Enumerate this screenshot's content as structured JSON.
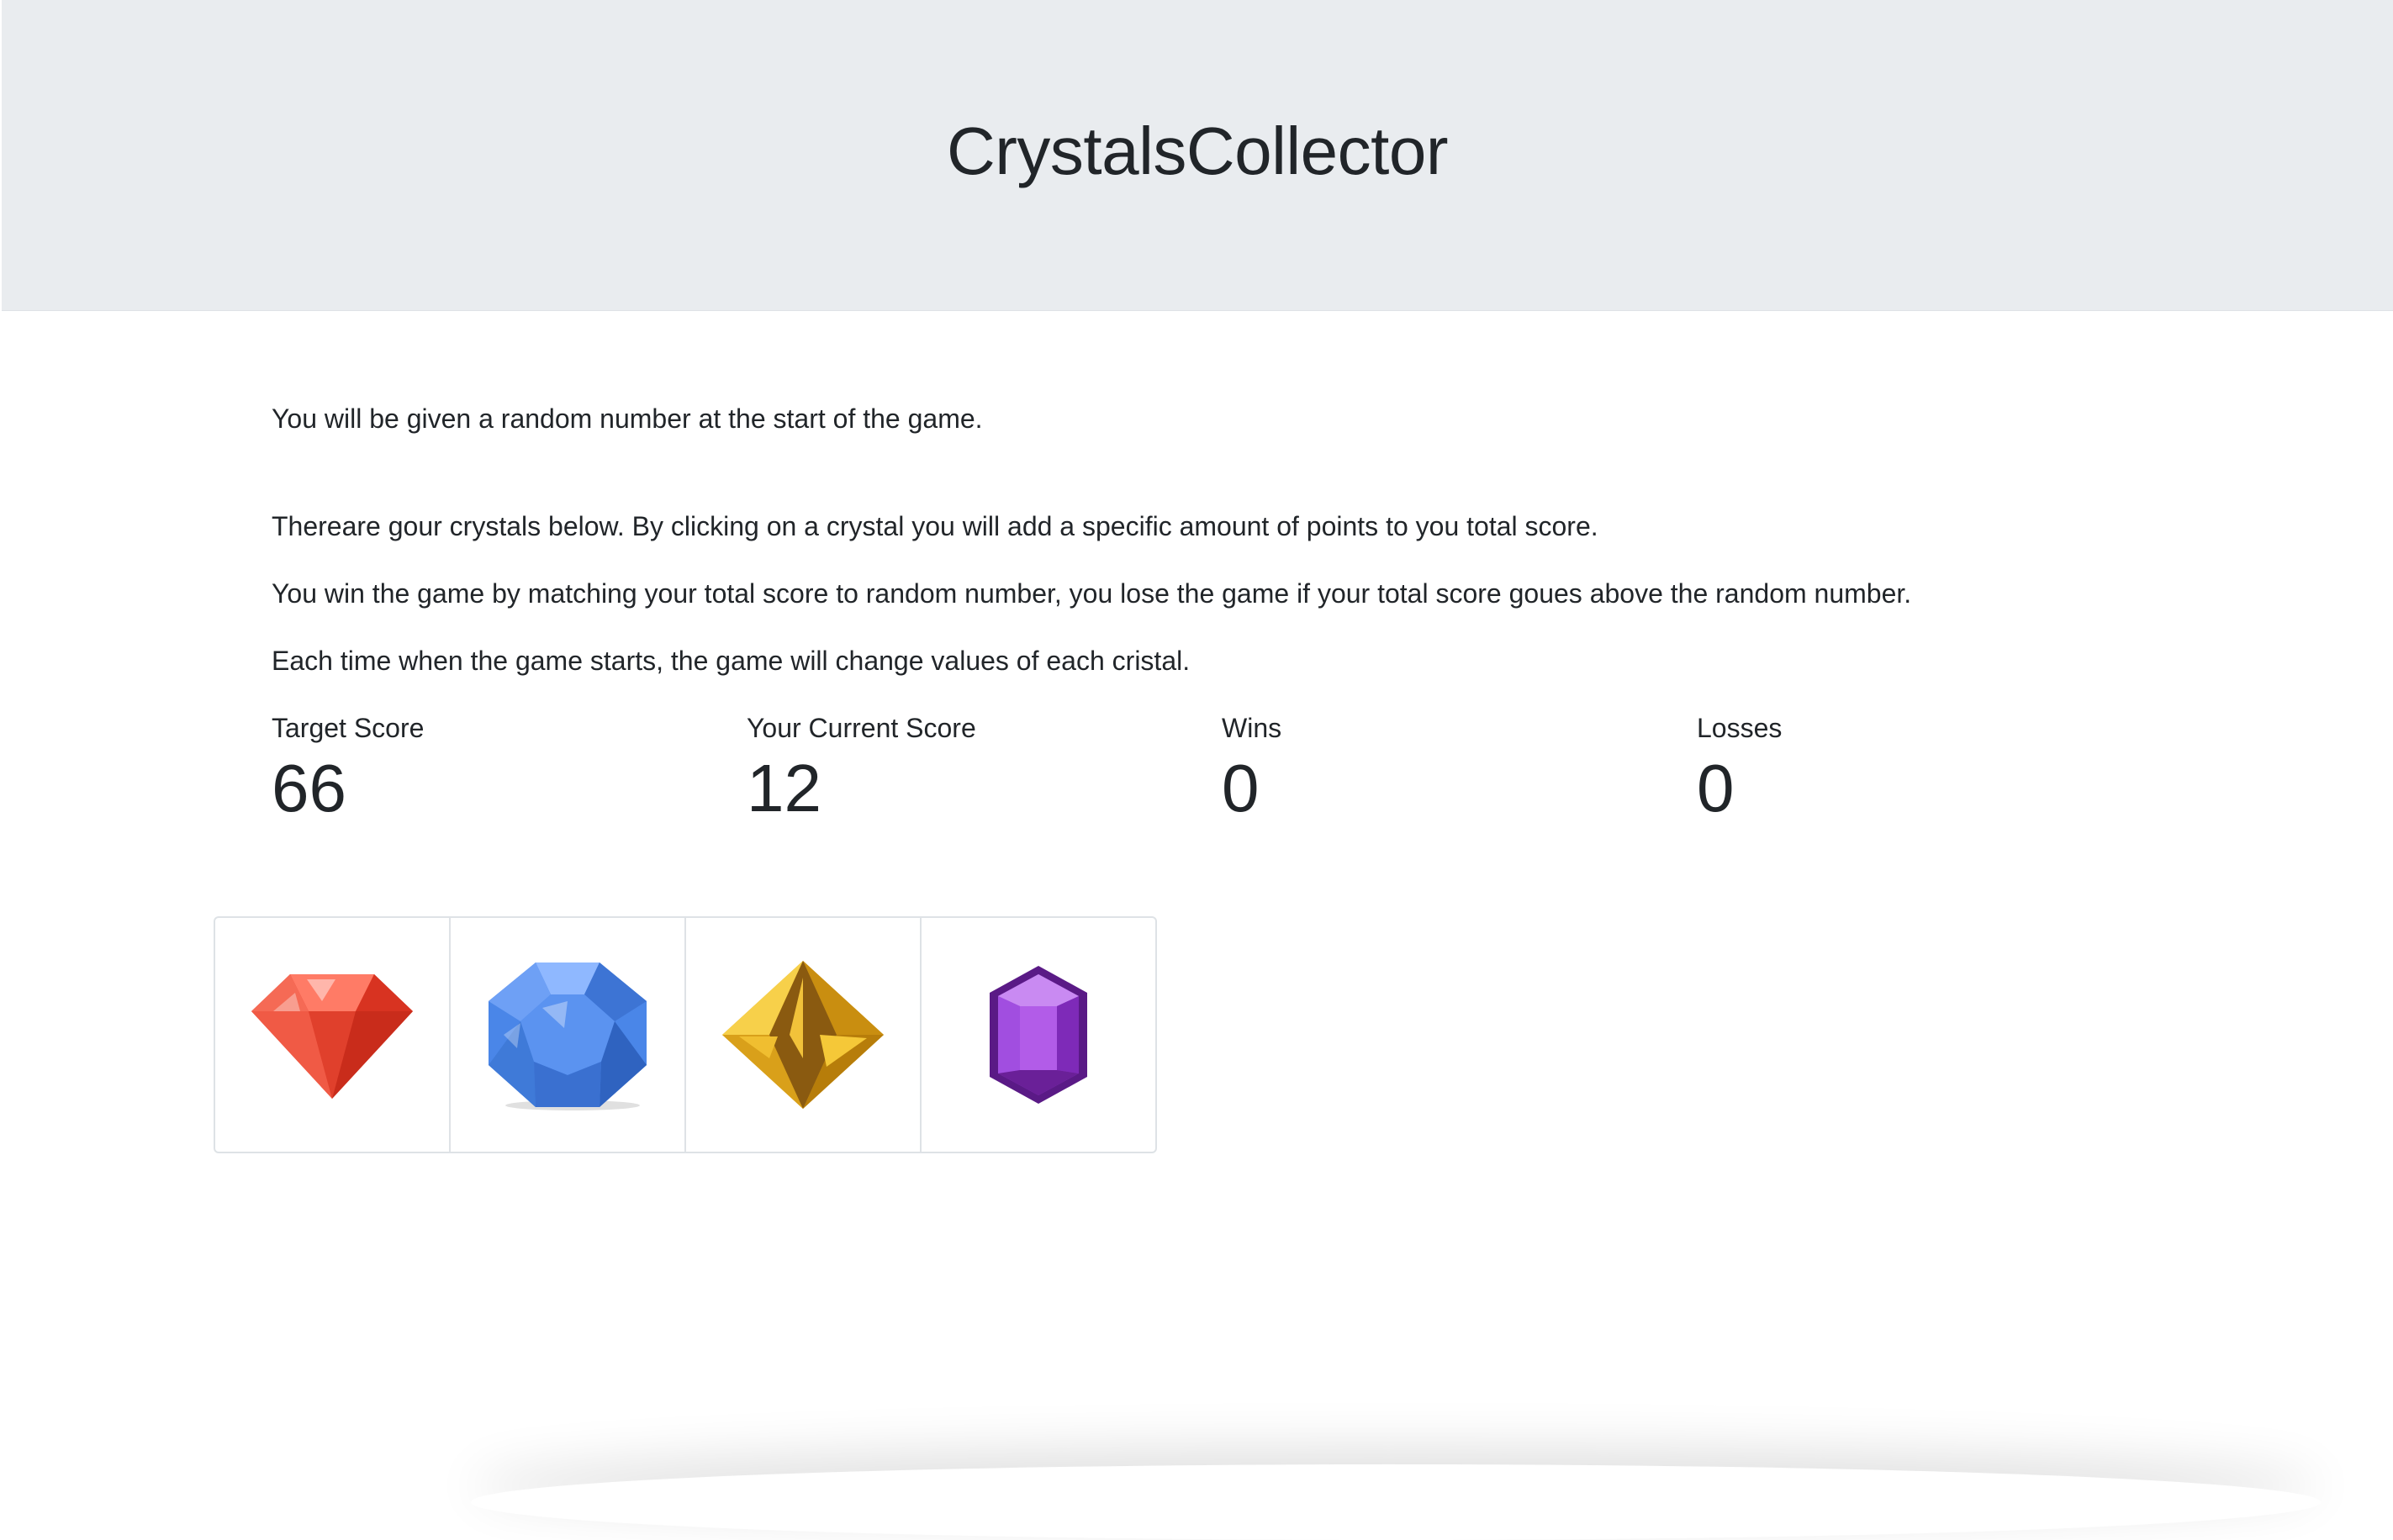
{
  "header": {
    "title": "CrystalsCollector"
  },
  "instructions": [
    "You will be given a random number at the start of the game.",
    "Thereare gour crystals below. By clicking on a crystal you will add a specific amount of points to you total score.",
    "You win the game by matching your total score to random number, you lose the game if your total score goues above the random number.",
    "Each time when the game starts, the game will change values of each cristal."
  ],
  "stats": {
    "target": {
      "label": "Target Score",
      "value": "66"
    },
    "current": {
      "label": "Your Current Score",
      "value": "12"
    },
    "wins": {
      "label": "Wins",
      "value": "0"
    },
    "losses": {
      "label": "Losses",
      "value": "0"
    }
  },
  "crystals": [
    {
      "name": "red-gem-icon",
      "color": "#e8412f"
    },
    {
      "name": "blue-gem-icon",
      "color": "#4a86e8"
    },
    {
      "name": "yellow-gem-icon",
      "color": "#e8b020"
    },
    {
      "name": "purple-gem-icon",
      "color": "#9b3fd6"
    }
  ]
}
